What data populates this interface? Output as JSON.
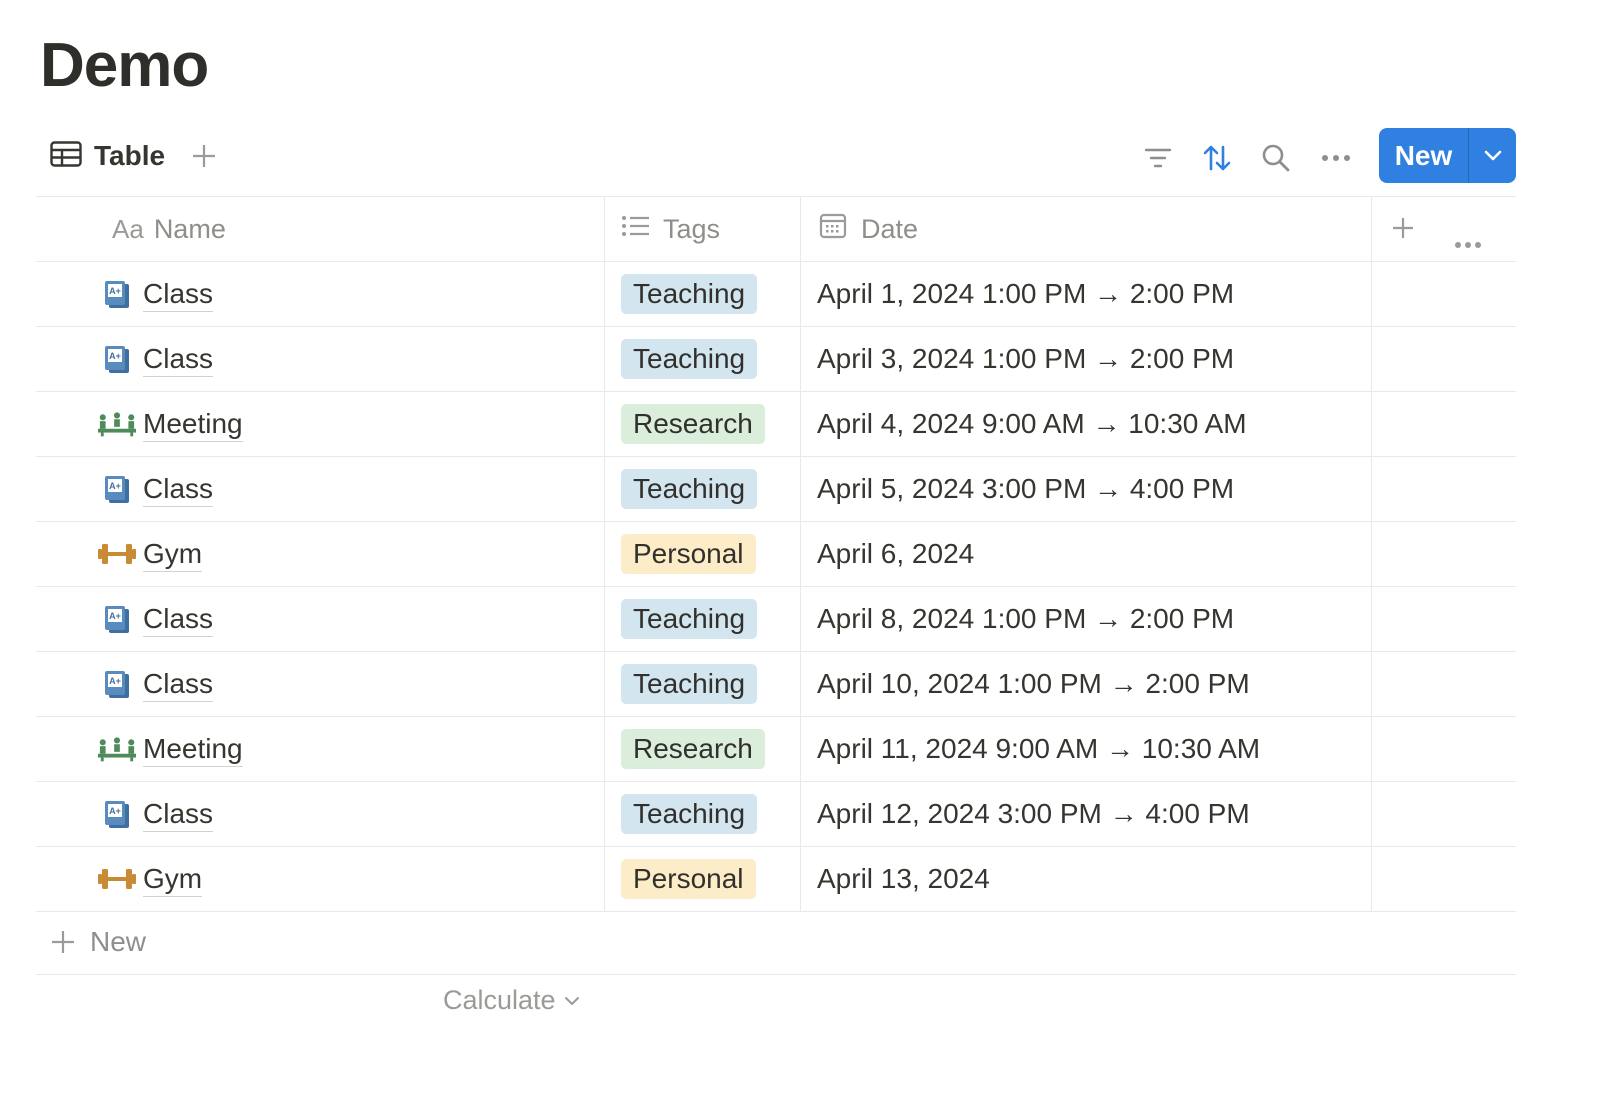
{
  "page": {
    "title": "Demo"
  },
  "toolbar": {
    "view_label": "Table",
    "view_icon": "table-icon",
    "icons": [
      "plus-icon",
      "filter-icon",
      "sort-icon",
      "search-icon",
      "more-icon",
      "chevron-down-icon"
    ],
    "new_label": "New",
    "accent_color": "#2f80e0",
    "sort_active_color": "#2f80e0"
  },
  "table": {
    "columns": [
      {
        "label": "Name",
        "icon": "Aa"
      },
      {
        "label": "Tags",
        "icon": "list-icon"
      },
      {
        "label": "Date",
        "icon": "calendar-icon"
      }
    ],
    "tag_colors": {
      "Teaching": "#d3e5ef",
      "Research": "#dbeddb",
      "Personal": "#fdecc8"
    },
    "rows": [
      {
        "icon": "grade-book-icon",
        "name": "Class",
        "tag": "Teaching",
        "date": "April 1, 2024 1:00 PM → 2:00 PM"
      },
      {
        "icon": "grade-book-icon",
        "name": "Class",
        "tag": "Teaching",
        "date": "April 3, 2024 1:00 PM → 2:00 PM"
      },
      {
        "icon": "meeting-icon",
        "name": "Meeting",
        "tag": "Research",
        "date": "April 4, 2024 9:00 AM → 10:30 AM"
      },
      {
        "icon": "grade-book-icon",
        "name": "Class",
        "tag": "Teaching",
        "date": "April 5, 2024 3:00 PM → 4:00 PM"
      },
      {
        "icon": "dumbbell-icon",
        "name": "Gym",
        "tag": "Personal",
        "date": "April 6, 2024"
      },
      {
        "icon": "grade-book-icon",
        "name": "Class",
        "tag": "Teaching",
        "date": "April 8, 2024 1:00 PM → 2:00 PM"
      },
      {
        "icon": "grade-book-icon",
        "name": "Class",
        "tag": "Teaching",
        "date": "April 10, 2024 1:00 PM → 2:00 PM"
      },
      {
        "icon": "meeting-icon",
        "name": "Meeting",
        "tag": "Research",
        "date": "April 11, 2024 9:00 AM → 10:30 AM"
      },
      {
        "icon": "grade-book-icon",
        "name": "Class",
        "tag": "Teaching",
        "date": "April 12, 2024 3:00 PM → 4:00 PM"
      },
      {
        "icon": "dumbbell-icon",
        "name": "Gym",
        "tag": "Personal",
        "date": "April 13, 2024"
      }
    ],
    "new_row_label": "New",
    "calculate_label": "Calculate"
  }
}
